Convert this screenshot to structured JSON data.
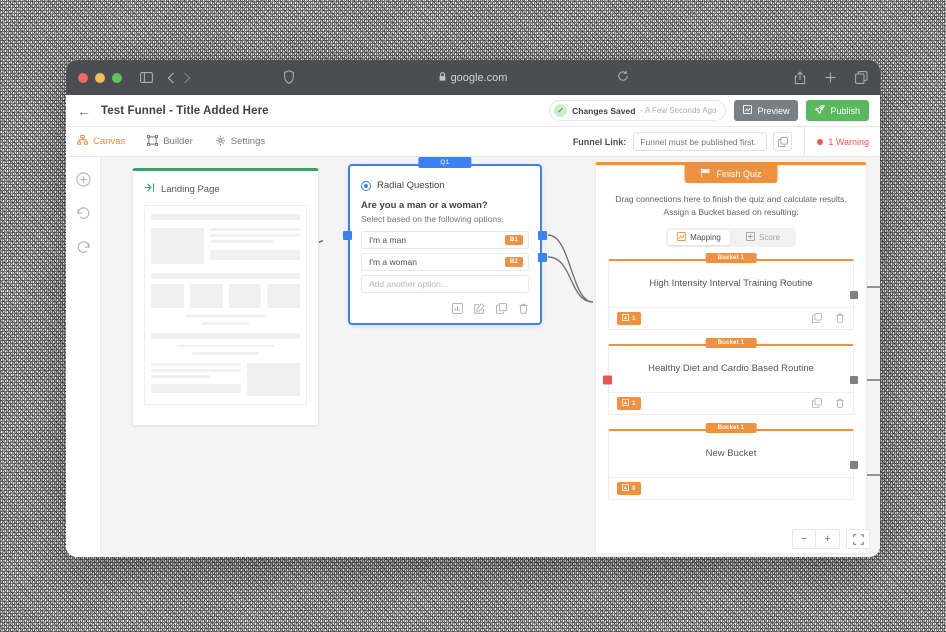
{
  "browser": {
    "url": "google.com",
    "lock_icon": "lock-icon",
    "traffic_lights": [
      "close-red",
      "minimize-yellow",
      "zoom-green"
    ],
    "icons": [
      "sidebar-toggle-icon",
      "back-arrow-icon",
      "forward-arrow-icon",
      "shield-icon",
      "reload-icon",
      "share-icon",
      "new-tab-icon",
      "tab-overview-icon"
    ]
  },
  "header": {
    "back_label": "←",
    "title": "Test Funnel - Title Added Here",
    "saved_label": "Changes Saved",
    "saved_time": "- A Few Seconds Ago",
    "preview_label": "Preview",
    "publish_label": "Publish"
  },
  "tabs": {
    "items": [
      {
        "label": "Canvas",
        "icon": "canvas-icon",
        "active": true
      },
      {
        "label": "Builder",
        "icon": "builder-icon",
        "active": false
      },
      {
        "label": "Settings",
        "icon": "gear-icon",
        "active": false
      }
    ],
    "funnel_link_label": "Funnel Link:",
    "funnel_link_value": "",
    "funnel_link_placeholder": "Funnel must be published first.",
    "copy_icon": "copy-icon",
    "warning_label": "1 Warning"
  },
  "rail": {
    "items": [
      {
        "name": "add-node-button",
        "icon": "plus-circle-icon"
      },
      {
        "name": "undo-button",
        "icon": "undo-icon"
      },
      {
        "name": "redo-button",
        "icon": "redo-icon"
      }
    ]
  },
  "landing_page": {
    "title": "Landing Page",
    "icon": "enter-arrow-icon",
    "accent": "#38a169"
  },
  "question_card": {
    "tab_label": "Q1",
    "type_label": "Radial Question",
    "question_text": "Are you a man or a woman?",
    "sub_text": "Select based on the following options:",
    "options": [
      {
        "text": "I'm a man",
        "bucket_tag": "B1"
      },
      {
        "text": "I'm a woman",
        "bucket_tag": "B2"
      }
    ],
    "add_option_placeholder": "Add another option...",
    "actions": [
      {
        "name": "insert-chart-button",
        "icon": "chart-icon"
      },
      {
        "name": "edit-button",
        "icon": "pencil-square-icon"
      },
      {
        "name": "duplicate-button",
        "icon": "copy-icon"
      },
      {
        "name": "delete-button",
        "icon": "trash-icon"
      }
    ],
    "accent": "#3b82f6"
  },
  "finish_quiz": {
    "tab_label": "Finish Quiz",
    "tab_icon": "flag-icon",
    "description_line1": "Drag connections here to finish the quiz and calculate results.",
    "description_line2": "Assign a Bucket based on resulting:",
    "modes": [
      {
        "label": "Mapping",
        "icon": "mapping-icon",
        "active": true
      },
      {
        "label": "Score",
        "icon": "score-icon",
        "active": false
      }
    ],
    "accent": "#f0913f",
    "buckets": [
      {
        "tag": "Bucket 1",
        "name": "High Intensity Interval Training Routine",
        "count": "1"
      },
      {
        "tag": "Bucket 1",
        "name": "Healthy Diet and Cardio Based Routine",
        "count": "1"
      },
      {
        "tag": "Bucket 1",
        "name": "New Bucket",
        "count": "0"
      }
    ],
    "bucket_actions": [
      {
        "name": "duplicate-bucket-button",
        "icon": "copy-icon"
      },
      {
        "name": "delete-bucket-button",
        "icon": "trash-icon"
      }
    ]
  },
  "zoom_controls": {
    "zoom_out": "−",
    "zoom_in": "+",
    "fit_icon": "fit-screen-icon"
  }
}
